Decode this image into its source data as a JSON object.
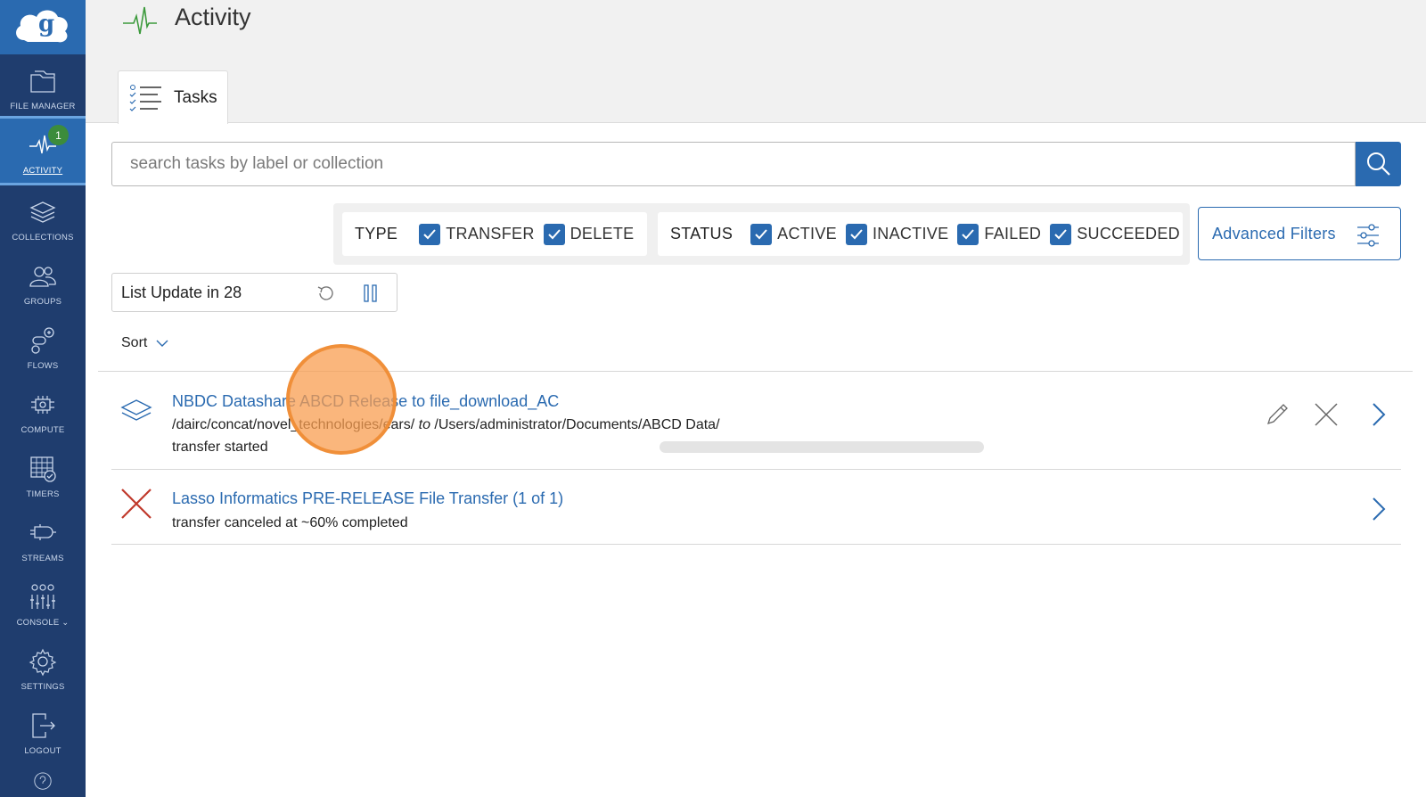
{
  "sidebar": {
    "items": [
      {
        "label": "FILE MANAGER",
        "icon": "folder-icon"
      },
      {
        "label": "ACTIVITY",
        "icon": "activity-icon",
        "badge": "1",
        "active": true
      },
      {
        "label": "COLLECTIONS",
        "icon": "layers-icon"
      },
      {
        "label": "GROUPS",
        "icon": "group-icon"
      },
      {
        "label": "FLOWS",
        "icon": "flows-icon"
      },
      {
        "label": "COMPUTE",
        "icon": "compute-icon"
      },
      {
        "label": "TIMERS",
        "icon": "timer-icon"
      },
      {
        "label": "STREAMS",
        "icon": "streams-icon"
      },
      {
        "label": "CONSOLE",
        "icon": "console-icon"
      },
      {
        "label": "SETTINGS",
        "icon": "gear-icon"
      },
      {
        "label": "LOGOUT",
        "icon": "logout-icon"
      }
    ]
  },
  "header": {
    "title": "Activity",
    "tab_label": "Tasks"
  },
  "search": {
    "placeholder": "search tasks by label or collection"
  },
  "filters": {
    "type_label": "TYPE",
    "type_options": [
      "TRANSFER",
      "DELETE"
    ],
    "status_label": "STATUS",
    "status_options": [
      "ACTIVE",
      "INACTIVE",
      "FAILED",
      "SUCCEEDED"
    ],
    "advanced_label": "Advanced Filters"
  },
  "list_update": {
    "text": "List Update in 28"
  },
  "sort": {
    "label": "Sort"
  },
  "tasks": [
    {
      "title": "NBDC Datashare ABCD Release to file_download_AC",
      "source": "/dairc/concat/novel_technologies/ears/",
      "to": "to",
      "destination": "/Users/administrator/Documents/ABCD Data/",
      "status": "transfer started",
      "state": "active"
    },
    {
      "title": "Lasso Informatics PRE-RELEASE File Transfer (1 of 1)",
      "status": "transfer canceled at ~60% completed",
      "state": "canceled"
    }
  ],
  "colors": {
    "sidebar": "#1f3d6e",
    "accent": "#2a6ab0",
    "badge": "#3c8c3c",
    "cancel": "#c0392b"
  }
}
